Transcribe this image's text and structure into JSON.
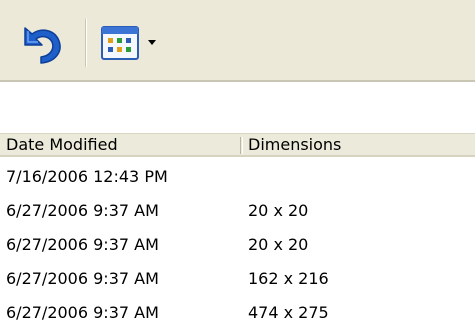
{
  "toolbar": {
    "undo_icon": "undo-arrow-icon",
    "views_icon": "views-grid-icon",
    "dropdown_icon": "chevron-down-icon",
    "accent_color": "#1f5fc9"
  },
  "file_table": {
    "columns": [
      {
        "label": "Date Modified"
      },
      {
        "label": "Dimensions"
      }
    ],
    "rows": [
      {
        "date_modified": "7/16/2006 12:43 PM",
        "dimensions": ""
      },
      {
        "date_modified": "6/27/2006 9:37 AM",
        "dimensions": "20 x 20"
      },
      {
        "date_modified": "6/27/2006 9:37 AM",
        "dimensions": "20 x 20"
      },
      {
        "date_modified": "6/27/2006 9:37 AM",
        "dimensions": "162 x 216"
      },
      {
        "date_modified": "6/27/2006 9:37 AM",
        "dimensions": "474 x 275"
      }
    ]
  }
}
